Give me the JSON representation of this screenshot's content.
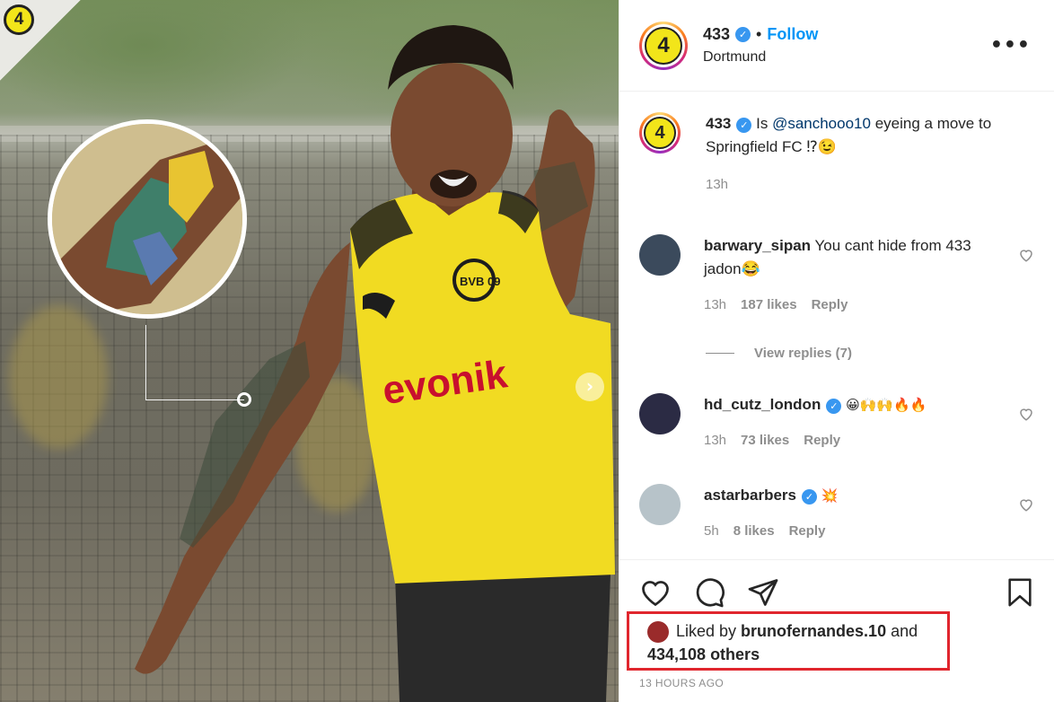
{
  "photo": {
    "corner_logo_text": "4",
    "next_icon": "chevron-right-icon",
    "shirt_sponsor": "evonik",
    "crest_text": "BVB 09"
  },
  "header": {
    "username": "433",
    "separator": "•",
    "follow_label": "Follow",
    "location": "Dortmund",
    "avatar_text": "4",
    "more_label": "•••"
  },
  "caption": {
    "username": "433",
    "text_prefix": "Is ",
    "mention": "@sanchooo10",
    "text_suffix": " eyeing a move to Springfield FC ⁉😉",
    "time": "13h",
    "avatar_text": "4"
  },
  "comments": [
    {
      "username": "barwary_sipan",
      "text": "You cant hide from 433 jadon😂",
      "time": "13h",
      "likes": "187 likes",
      "reply": "Reply",
      "verified": false
    },
    {
      "username": "hd_cutz_london",
      "text": "😀🙌🙌🔥🔥",
      "time": "13h",
      "likes": "73 likes",
      "reply": "Reply",
      "verified": true
    },
    {
      "username": "astarbarbers",
      "text": "💥",
      "time": "5h",
      "likes": "8 likes",
      "reply": "Reply",
      "verified": true
    }
  ],
  "view_replies": "View replies (7)",
  "likes": {
    "prefix": "Liked by ",
    "user": "brunofernandes.10",
    "and": " and",
    "others": "434,108 others"
  },
  "timestamp": "13 HOURS AGO",
  "colors": {
    "accent": "#0095f6",
    "highlight_box": "#e0262e",
    "muted": "#8e8e8e"
  }
}
